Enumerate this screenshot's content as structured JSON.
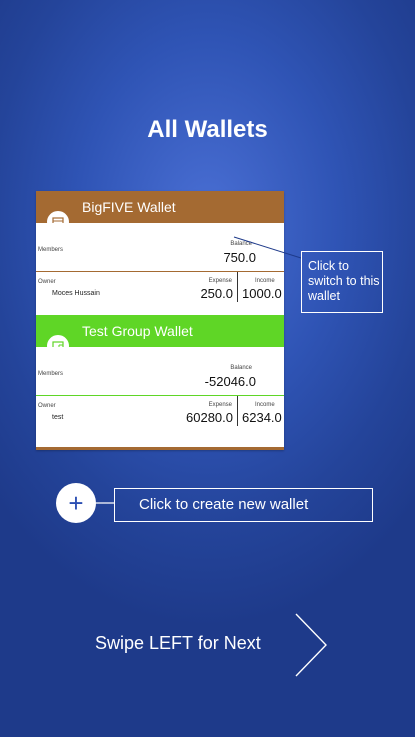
{
  "title": "All Wallets",
  "wallets": [
    {
      "name": "BigFIVE Wallet",
      "members_label": "Members",
      "balance_label": "Balance",
      "balance": "750.0",
      "owner_label": "Owner",
      "owner": "Moces Hussain",
      "expense_label": "Expense",
      "expense": "250.0",
      "income_label": "Income",
      "income": "1000.0",
      "color": "#a46a32",
      "icon": "wallet-icon"
    },
    {
      "name": "Test Group Wallet",
      "members_label": "Members",
      "balance_label": "Balance",
      "balance": "-52046.0",
      "owner_label": "Owner",
      "owner": "test",
      "expense_label": "Expense",
      "expense": "60280.0",
      "income_label": "Income",
      "income": "6234.0",
      "color": "#5fd626",
      "icon": "wallet-icon"
    }
  ],
  "callouts": {
    "switch": "Click to switch to this wallet",
    "create": "Click to create new wallet"
  },
  "add_button": {
    "symbol": "+"
  },
  "swipe_hint": "Swipe LEFT for Next",
  "colors": {
    "background": "#2f54b5",
    "accent_brown": "#a46a32",
    "accent_green": "#5fd626"
  }
}
